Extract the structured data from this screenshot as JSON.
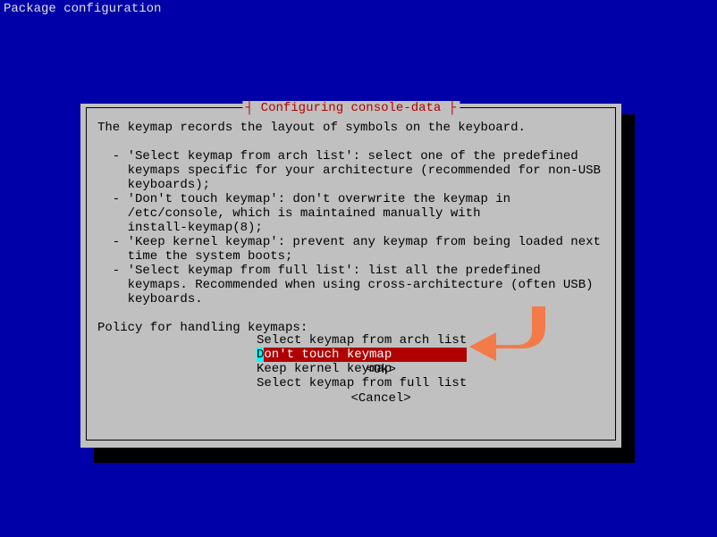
{
  "header": "Package configuration",
  "dialog": {
    "title": "┤ Configuring console-data ├",
    "intro": "The keymap records the layout of symbols on the keyboard.",
    "bullets": [
      "'Select keymap from arch list': select one of the predefined keymaps specific for your architecture (recommended for non-USB keyboards);",
      "'Don't touch keymap': don't overwrite the keymap in /etc/console, which is maintained manually with install-keymap(8);",
      "'Keep kernel keymap': prevent any keymap from being loaded next time the system boots;",
      "'Select keymap from full list': list all the predefined keymaps. Recommended when using cross-architecture (often USB) keyboards."
    ],
    "prompt": "Policy for handling keymaps:",
    "options": [
      "Select keymap from arch list",
      "Don't touch keymap",
      "Keep kernel keymap",
      "Select keymap from full list"
    ],
    "selected_index": 1,
    "buttons": {
      "ok": "<Ok>",
      "cancel": "<Cancel>"
    }
  },
  "arrow_color": "#f47a4a"
}
